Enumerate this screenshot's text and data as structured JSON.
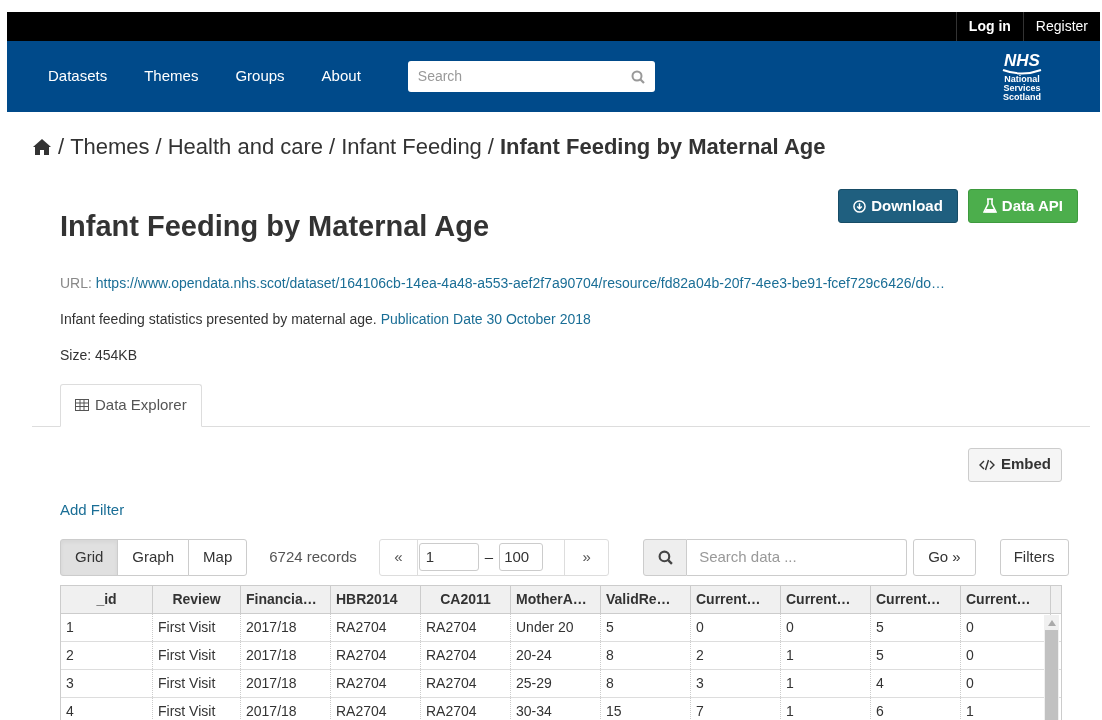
{
  "account_links": [
    "Log in",
    "Register"
  ],
  "nav": {
    "items": [
      "Datasets",
      "Themes",
      "Groups",
      "About"
    ],
    "search_placeholder": "Search",
    "logo": {
      "name": "NHS",
      "lines": [
        "National",
        "Services",
        "Scotland"
      ]
    }
  },
  "breadcrumb": {
    "separator": "/",
    "items": [
      {
        "label": "Themes",
        "current": false
      },
      {
        "label": "Health and care",
        "current": false
      },
      {
        "label": "Infant Feeding",
        "current": false
      },
      {
        "label": "Infant Feeding by Maternal Age",
        "current": true
      }
    ]
  },
  "resource": {
    "title": "Infant Feeding by Maternal Age",
    "buttons": [
      {
        "kind": "download",
        "label": "Download"
      },
      {
        "kind": "api",
        "label": "Data API"
      }
    ],
    "url_label": "URL:",
    "url": "https://www.opendata.nhs.scot/dataset/164106cb-14ea-4a48-a553-aef2f7a90704/resource/fd82a04b-20f7-4ee3-be91-fcef729c6426/do…",
    "description": "Infant feeding statistics presented by maternal age.",
    "publication": "Publication Date 30 October 2018",
    "size": "Size: 454KB"
  },
  "tabs": [
    {
      "label": "Data Explorer",
      "selected": true
    }
  ],
  "embed_button": "Embed",
  "add_filter": "Add Filter",
  "views": [
    {
      "label": "Grid",
      "selected": true
    },
    {
      "label": "Graph",
      "selected": false
    },
    {
      "label": "Map",
      "selected": false
    }
  ],
  "record_count": "6724 records",
  "pager": {
    "prev": "«",
    "from": "1",
    "dash": "–",
    "to": "100",
    "next": "»"
  },
  "data_search": {
    "placeholder": "Search data ...",
    "go": "Go »"
  },
  "filters_button": "Filters",
  "table": {
    "columns": [
      "_id",
      "Review",
      "Financia…",
      "HBR2014",
      "CA2011",
      "MotherA…",
      "ValidRe…",
      "Current…",
      "Current…",
      "Current…",
      "Current…"
    ],
    "rows": [
      [
        "1",
        "First Visit",
        "2017/18",
        "RA2704",
        "RA2704",
        "Under 20",
        "5",
        "0",
        "0",
        "5",
        "0"
      ],
      [
        "2",
        "First Visit",
        "2017/18",
        "RA2704",
        "RA2704",
        "20-24",
        "8",
        "2",
        "1",
        "5",
        "0"
      ],
      [
        "3",
        "First Visit",
        "2017/18",
        "RA2704",
        "RA2704",
        "25-29",
        "8",
        "3",
        "1",
        "4",
        "0"
      ],
      [
        "4",
        "First Visit",
        "2017/18",
        "RA2704",
        "RA2704",
        "30-34",
        "15",
        "7",
        "1",
        "6",
        "1"
      ]
    ]
  }
}
